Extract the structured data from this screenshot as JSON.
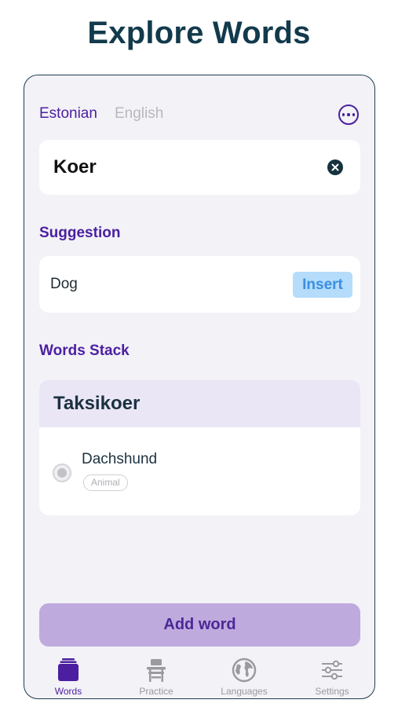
{
  "page_title": "Explore Words",
  "languages": {
    "active": "Estonian",
    "inactive": "English"
  },
  "more_icon": "ellipsis-circle-icon",
  "search": {
    "value": "Koer",
    "clear_icon": "clear-x-icon"
  },
  "suggestion": {
    "heading": "Suggestion",
    "text": "Dog",
    "insert_label": "Insert"
  },
  "words_stack": {
    "heading": "Words Stack",
    "title": "Taksikoer",
    "items": [
      {
        "word": "Dachshund",
        "tag": "Animal"
      }
    ]
  },
  "add_word_label": "Add word",
  "tabbar": [
    {
      "label": "Words",
      "icon": "stack-icon",
      "active": true
    },
    {
      "label": "Practice",
      "icon": "desk-icon",
      "active": false
    },
    {
      "label": "Languages",
      "icon": "globe-icon",
      "active": false
    },
    {
      "label": "Settings",
      "icon": "sliders-icon",
      "active": false
    }
  ],
  "colors": {
    "accent": "#4b1fa0",
    "title": "#123a4c",
    "background": "#f2f2f7",
    "insert_bg": "#b5dcfb",
    "add_button_bg": "#bfaade"
  }
}
